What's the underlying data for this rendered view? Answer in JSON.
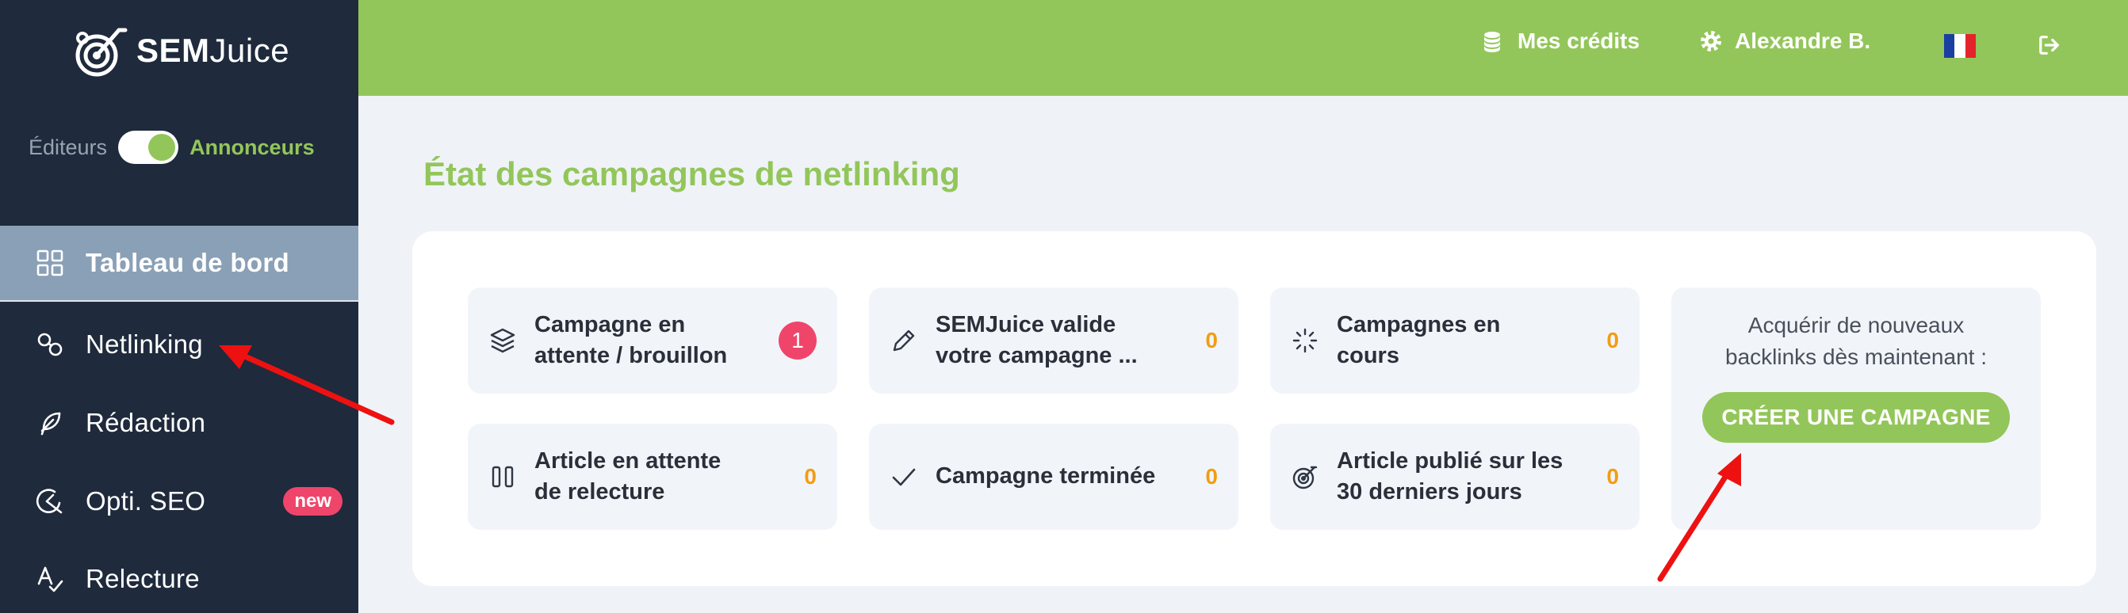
{
  "app": {
    "logo_prefix": "SEM",
    "logo_suffix": "Juice"
  },
  "mode_switch": {
    "left_label": "Éditeurs",
    "right_label": "Annonceurs",
    "state": "on"
  },
  "sidebar": {
    "items": [
      {
        "label": "Tableau de bord",
        "icon": "dashboard-grid-icon",
        "active": true
      },
      {
        "label": "Netlinking",
        "icon": "link-icon"
      },
      {
        "label": "Rédaction",
        "icon": "feather-icon"
      },
      {
        "label": "Opti. SEO",
        "icon": "seo-optimization-icon",
        "badge": "new"
      },
      {
        "label": "Relecture",
        "icon": "spellcheck-icon"
      }
    ]
  },
  "topbar": {
    "credits_label": "Mes crédits",
    "user_name": "Alexandre B.",
    "language_flag": "fr-flag",
    "logout_icon": "logout-icon"
  },
  "main": {
    "title": "État des campagnes de netlinking",
    "stats": [
      {
        "label": "Campagne en attente / brouillon",
        "line1": "Campagne en",
        "line2": "attente / brouillon",
        "count": "1",
        "icon": "layers-icon"
      },
      {
        "label": "SEMJuice valide votre campagne ...",
        "line1": "SEMJuice valide",
        "line2": "votre campagne ...",
        "count": "0",
        "icon": "pencil-icon"
      },
      {
        "label": "Campagnes en cours",
        "line1": "Campagnes en",
        "line2": "cours",
        "count": "0",
        "icon": "loading-spinner-icon"
      },
      {
        "label": "Article en attente de relecture",
        "line1": "Article en attente",
        "line2": "de relecture",
        "count": "0",
        "icon": "pause-icon"
      },
      {
        "label": "Campagne terminée",
        "line1": "Campagne terminée",
        "line2": "",
        "count": "0",
        "icon": "check-icon"
      },
      {
        "label": "Article publié sur les 30 derniers jours",
        "line1": "Article publié sur les",
        "line2": "30 derniers jours",
        "count": "0",
        "icon": "target-icon"
      }
    ],
    "cta": {
      "text_line1": "Acquérir de nouveaux",
      "text_line2": "backlinks dès maintenant :",
      "button_label": "CRÉER UNE CAMPAGNE"
    }
  },
  "colors": {
    "brand_green": "#93c65a",
    "sidebar_bg": "#1f2a3c",
    "active_item_bg": "#8aa0b6",
    "badge_red": "#f0456b",
    "count_orange": "#f39c12",
    "annotation_arrow": "#ee1111"
  }
}
